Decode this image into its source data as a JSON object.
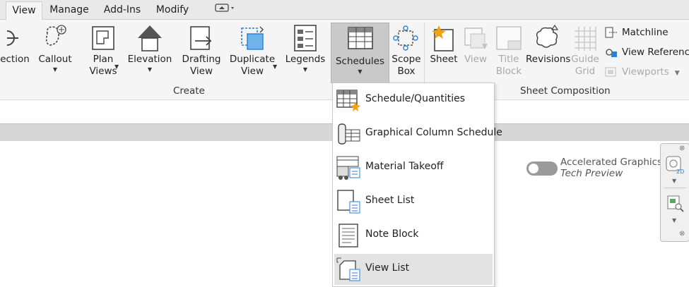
{
  "tabs": [
    {
      "label": "View",
      "active": true
    },
    {
      "label": "Manage"
    },
    {
      "label": "Add-Ins"
    },
    {
      "label": "Modify"
    }
  ],
  "ribbon": {
    "create": {
      "title": "Create",
      "buttons": [
        {
          "label": "ection"
        },
        {
          "label": "Callout"
        },
        {
          "label": "Plan\nViews"
        },
        {
          "label": "Elevation"
        },
        {
          "label": "Drafting\nView"
        },
        {
          "label": "Duplicate\nView"
        },
        {
          "label": "Legends"
        },
        {
          "label": "Schedules"
        },
        {
          "label": "Scope\nBox"
        }
      ]
    },
    "sheet_composition": {
      "title": "Sheet Composition",
      "buttons": [
        {
          "label": "Sheet"
        },
        {
          "label": "View"
        },
        {
          "label": "Title\nBlock"
        },
        {
          "label": "Revisions"
        },
        {
          "label": "Guide\nGrid"
        }
      ],
      "small_buttons": [
        {
          "label": "Matchline"
        },
        {
          "label": "View Referenc"
        },
        {
          "label": "Viewports"
        }
      ]
    }
  },
  "schedules_menu": {
    "items": [
      {
        "label": "Schedule/Quantities"
      },
      {
        "label": "Graphical Column Schedule"
      },
      {
        "label": "Material Takeoff"
      },
      {
        "label": "Sheet List"
      },
      {
        "label": "Note Block"
      },
      {
        "label": "View List",
        "highlighted": true
      }
    ]
  },
  "accelerated_graphics": {
    "line1": "Accelerated Graphics",
    "line2": "Tech Preview",
    "enabled": false
  },
  "colors": {
    "ribbon_bg": "#f5f5f5",
    "selected": "#c9c9c9",
    "accent_blue": "#2b7fd4",
    "star": "#f2a20a"
  }
}
